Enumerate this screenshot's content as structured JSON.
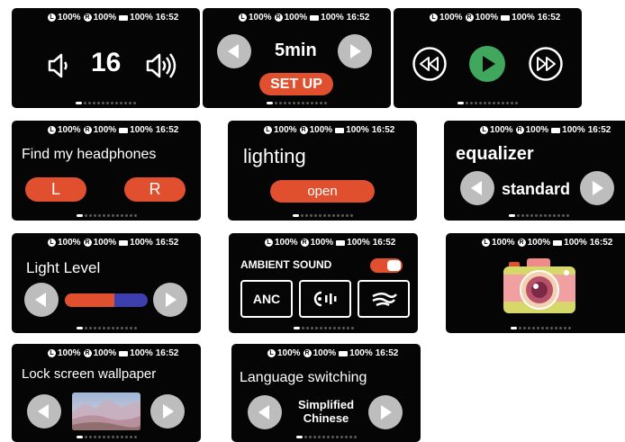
{
  "status": {
    "left_pct": "100%",
    "right_pct": "100%",
    "battery_pct": "100%",
    "time": "16:52",
    "left_glyph": "L",
    "right_glyph": "R"
  },
  "volume": {
    "value": "16",
    "icons": [
      "volume-down-icon",
      "volume-up-icon"
    ]
  },
  "timer": {
    "value": "5min",
    "action": "SET UP"
  },
  "playback": {
    "icons": [
      "rewind-icon",
      "play-icon",
      "fast-forward-icon"
    ],
    "accent": "#3fa85c"
  },
  "find": {
    "title": "Find my headphones",
    "left": "L",
    "right": "R"
  },
  "lighting": {
    "title": "lighting",
    "action": "open"
  },
  "equalizer": {
    "title": "equalizer",
    "value": "standard"
  },
  "light_level": {
    "title": "Light Level",
    "level": 0.6,
    "fill_color": "#e0502e",
    "track_color": "#3d3faf"
  },
  "ambient": {
    "title": "AMBIENT SOUND",
    "toggle_on": true,
    "modes": [
      "ANC",
      "transparency-icon",
      "wind-icon"
    ]
  },
  "camera": {
    "icon": "camera-icon"
  },
  "wallpaper": {
    "title": "Lock screen wallpaper"
  },
  "language": {
    "title": "Language switching",
    "line1": "Simplified",
    "line2": "Chinese"
  },
  "colors": {
    "accent": "#e0502e",
    "nav_button": "#bdbdbd",
    "card_bg": "#050505"
  }
}
